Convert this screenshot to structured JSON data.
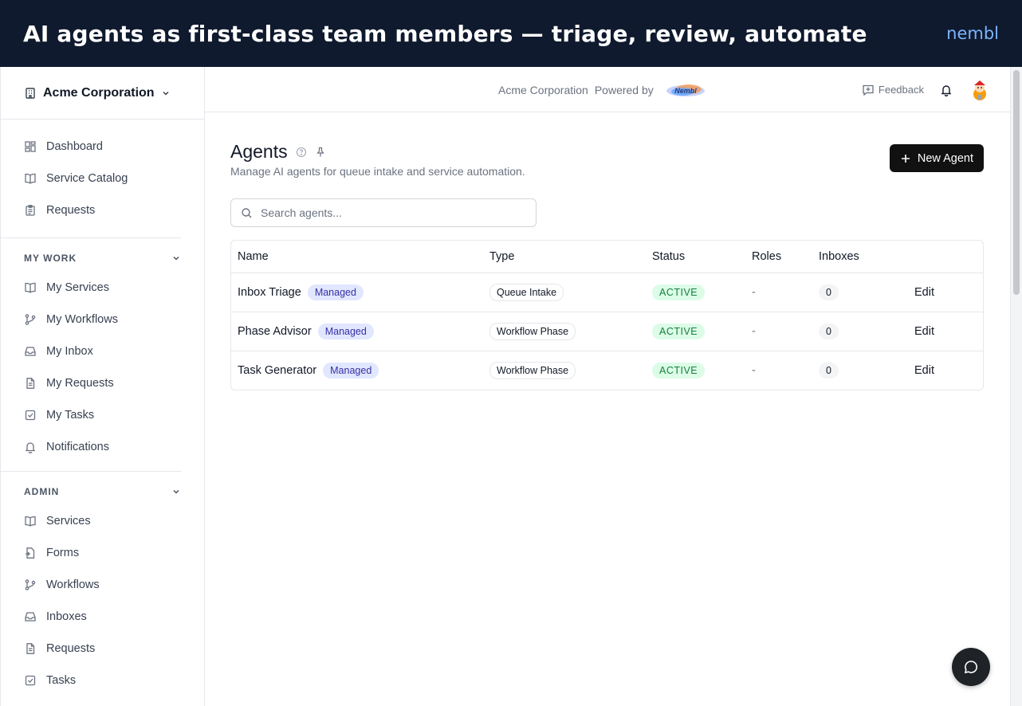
{
  "banner": {
    "title": "AI agents as first-class team members — triage, review, automate",
    "brand": "nembl"
  },
  "sidebar": {
    "org_name": "Acme Corporation",
    "main_items": [
      {
        "label": "Dashboard",
        "icon": "dashboard-icon"
      },
      {
        "label": "Service Catalog",
        "icon": "book-icon"
      },
      {
        "label": "Requests",
        "icon": "clipboard-icon"
      }
    ],
    "my_work": {
      "label": "MY WORK",
      "items": [
        {
          "label": "My Services",
          "icon": "book-icon"
        },
        {
          "label": "My Workflows",
          "icon": "workflow-icon"
        },
        {
          "label": "My Inbox",
          "icon": "inbox-icon"
        },
        {
          "label": "My Requests",
          "icon": "document-icon"
        },
        {
          "label": "My Tasks",
          "icon": "check-square-icon"
        },
        {
          "label": "Notifications",
          "icon": "bell-icon"
        }
      ]
    },
    "admin": {
      "label": "ADMIN",
      "items": [
        {
          "label": "Services",
          "icon": "book-icon"
        },
        {
          "label": "Forms",
          "icon": "form-icon"
        },
        {
          "label": "Workflows",
          "icon": "workflow-icon"
        },
        {
          "label": "Inboxes",
          "icon": "inbox-icon"
        },
        {
          "label": "Requests",
          "icon": "document-icon"
        },
        {
          "label": "Tasks",
          "icon": "check-square-icon"
        }
      ]
    }
  },
  "topbar": {
    "org_name": "Acme Corporation",
    "powered_by": "Powered by",
    "feedback_label": "Feedback"
  },
  "page": {
    "title": "Agents",
    "subtitle": "Manage AI agents for queue intake and service automation.",
    "new_button_label": "New Agent",
    "search_placeholder": "Search agents..."
  },
  "table": {
    "columns": [
      "Name",
      "Type",
      "Status",
      "Roles",
      "Inboxes",
      ""
    ],
    "rows": [
      {
        "name": "Inbox Triage",
        "badge": "Managed",
        "type": "Queue Intake",
        "status": "ACTIVE",
        "roles": "-",
        "inboxes": "0",
        "action": "Edit"
      },
      {
        "name": "Phase Advisor",
        "badge": "Managed",
        "type": "Workflow Phase",
        "status": "ACTIVE",
        "roles": "-",
        "inboxes": "0",
        "action": "Edit"
      },
      {
        "name": "Task Generator",
        "badge": "Managed",
        "type": "Workflow Phase",
        "status": "ACTIVE",
        "roles": "-",
        "inboxes": "0",
        "action": "Edit"
      }
    ]
  },
  "colors": {
    "banner_bg": "#0f1a2e",
    "brand_accent": "#7cb3ff",
    "primary_button": "#111111",
    "status_active_bg": "#dcfce7",
    "status_active_text": "#15803d",
    "managed_bg": "#e0e7ff"
  }
}
